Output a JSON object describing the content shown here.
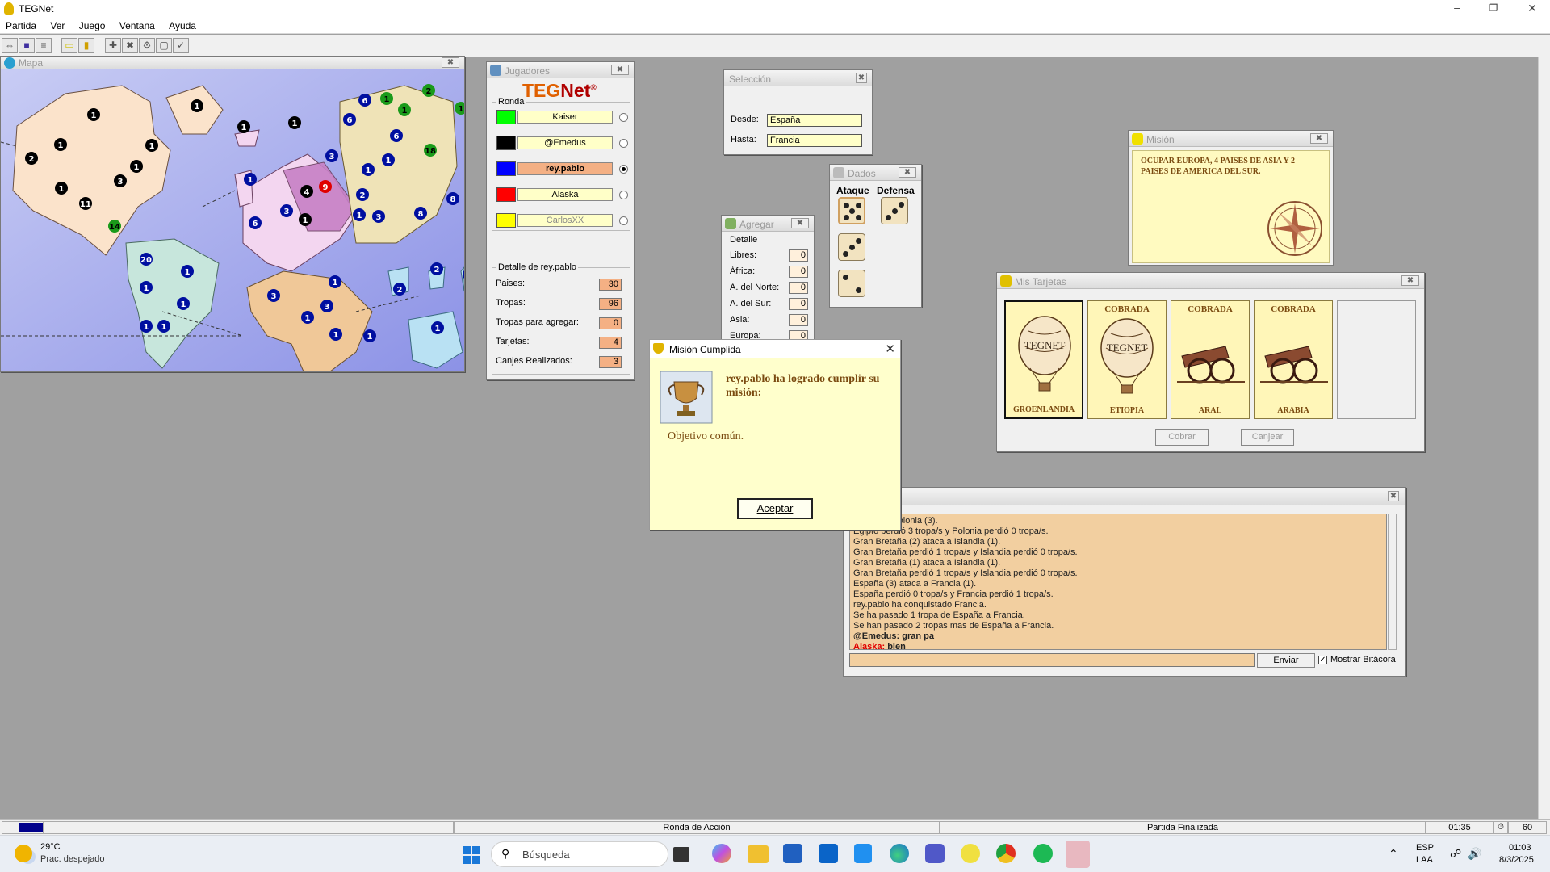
{
  "app": {
    "title": "TEGNet"
  },
  "menu": [
    "Partida",
    "Ver",
    "Juego",
    "Ventana",
    "Ayuda"
  ],
  "map_window": {
    "title": "Mapa"
  },
  "players_window": {
    "title": "Jugadores",
    "logo_teg": "TEG",
    "logo_net": "Net",
    "logo_reg": "®",
    "round_label": "Ronda",
    "players": [
      {
        "name": "Kaiser",
        "color": "#00ff00",
        "active": false
      },
      {
        "name": "@Emedus",
        "color": "#000000",
        "active": false
      },
      {
        "name": "rey.pablo",
        "color": "#0000ff",
        "active": true
      },
      {
        "name": "Alaska",
        "color": "#ff0000",
        "active": false
      },
      {
        "name": "CarlosXX",
        "color": "#ffff00",
        "active": false
      }
    ],
    "detail_title": "Detalle de rey.pablo",
    "details": [
      {
        "label": "Paises:",
        "value": "30"
      },
      {
        "label": "Tropas:",
        "value": "96"
      },
      {
        "label": "Tropas para agregar:",
        "value": "0"
      },
      {
        "label": "Tarjetas:",
        "value": "4"
      },
      {
        "label": "Canjes Realizados:",
        "value": "3"
      }
    ]
  },
  "selection_window": {
    "title": "Selección",
    "from_label": "Desde:",
    "from_value": "España",
    "to_label": "Hasta:",
    "to_value": "Francia"
  },
  "dice_window": {
    "title": "Dados",
    "attack_label": "Ataque",
    "defense_label": "Defensa"
  },
  "add_window": {
    "title": "Agregar",
    "group_label": "Detalle",
    "rows": [
      {
        "label": "Libres:",
        "value": "0"
      },
      {
        "label": "África:",
        "value": "0"
      },
      {
        "label": "A. del Norte:",
        "value": "0"
      },
      {
        "label": "A. del Sur:",
        "value": "0"
      },
      {
        "label": "Asia:",
        "value": "0"
      },
      {
        "label": "Europa:",
        "value": "0"
      }
    ]
  },
  "mission_window": {
    "title": "Misión",
    "text": "OCUPAR EUROPA, 4 PAISES DE ASIA Y 2 PAISES DE AMERICA DEL SUR."
  },
  "cards_window": {
    "title": "Mis Tarjetas",
    "cards": [
      {
        "status": "",
        "country": "GROENLANDIA",
        "symbol": "balloon"
      },
      {
        "status": "COBRADA",
        "country": "ETIOPIA",
        "symbol": "balloon"
      },
      {
        "status": "COBRADA",
        "country": "ARAL",
        "symbol": "cannon"
      },
      {
        "status": "COBRADA",
        "country": "ARABIA",
        "symbol": "cannon"
      }
    ],
    "collect_button": "Cobrar",
    "exchange_button": "Canjear"
  },
  "chat_window": {
    "lines": [
      {
        "text": "...ataca a Polonia (3).",
        "kind": "log"
      },
      {
        "text": "Egipto perdió 3 tropa/s y Polonia perdió 0 tropa/s.",
        "kind": "log"
      },
      {
        "text": "Gran Bretaña (2) ataca a Islandia (1).",
        "kind": "log"
      },
      {
        "text": "Gran Bretaña perdió 1 tropa/s y Islandia perdió 0 tropa/s.",
        "kind": "log"
      },
      {
        "text": "Gran Bretaña (1) ataca a Islandia (1).",
        "kind": "log"
      },
      {
        "text": "Gran Bretaña perdió 1 tropa/s y Islandia perdió 0 tropa/s.",
        "kind": "log"
      },
      {
        "text": "España (3) ataca a Francia (1).",
        "kind": "log"
      },
      {
        "text": "España perdió 0 tropa/s y Francia perdió 1 tropa/s.",
        "kind": "log"
      },
      {
        "text": "rey.pablo ha conquistado Francia.",
        "kind": "log"
      },
      {
        "text": "Se ha pasado 1 tropa de España a Francia.",
        "kind": "log"
      },
      {
        "text": "Se han pasado 2 tropas mas de España a Francia.",
        "kind": "log"
      }
    ],
    "msg1_user": "@Emedus:",
    "msg1_text": "gran pa",
    "msg2_user": "Alaska:",
    "msg2_text": "bien",
    "send_button": "Enviar",
    "show_log_label": "Mostrar Bitácora",
    "show_log_checked": true
  },
  "dialog": {
    "title": "Misión Cumplida",
    "heading": "rey.pablo ha logrado cumplir su misión:",
    "body": "Objetivo común.",
    "accept": "Aceptar"
  },
  "statusbar": {
    "phase": "Ronda de Acción",
    "state": "Partida Finalizada",
    "time": "01:35",
    "seconds": "60"
  },
  "taskbar": {
    "weather_temp": "29°C",
    "weather_desc": "Prac. despejado",
    "search_placeholder": "Búsqueda",
    "lang1": "ESP",
    "lang2": "LAA",
    "clock_time": "01:03",
    "clock_date": "8/3/2025"
  }
}
